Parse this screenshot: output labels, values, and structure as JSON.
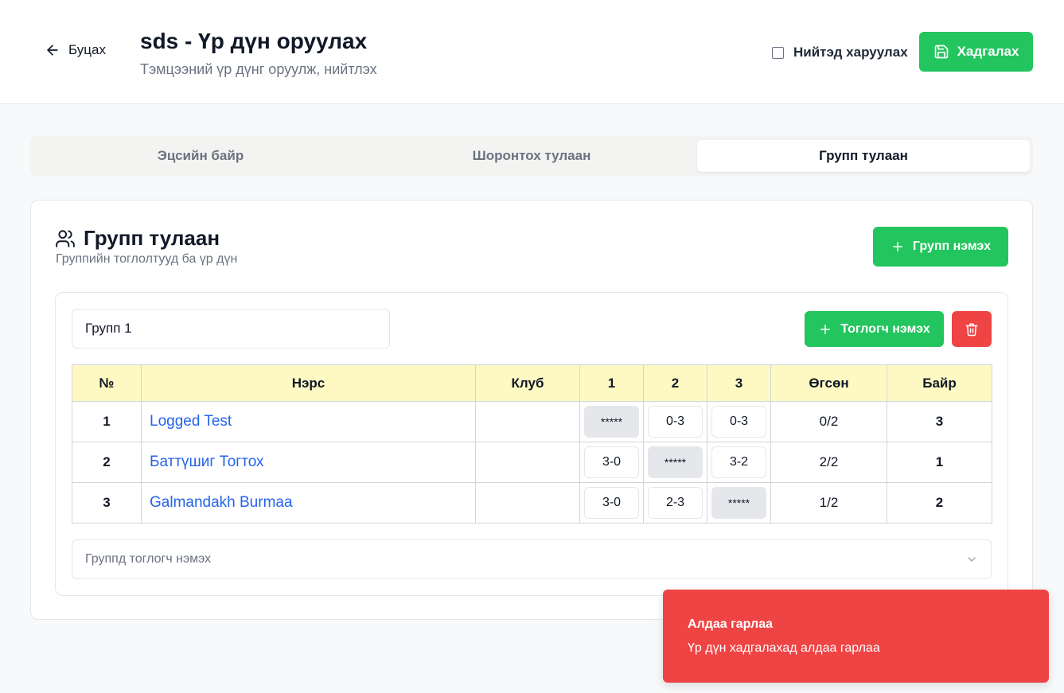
{
  "header": {
    "back_label": "Буцах",
    "title": "sds - Үр дүн оруулах",
    "subtitle": "Тэмцээний үр дүнг оруулж, нийтлэх",
    "publish_label": "Нийтэд харуулах",
    "publish_checked": false,
    "save_label": "Хадгалах"
  },
  "tabs": [
    {
      "label": "Эцсийн байр",
      "active": false
    },
    {
      "label": "Шоронтох тулаан",
      "active": false
    },
    {
      "label": "Групп тулаан",
      "active": true
    }
  ],
  "section": {
    "title": "Групп тулаан",
    "subtitle": "Группийн тоглолтууд ба үр дүн",
    "add_group_label": "Групп нэмэх"
  },
  "group": {
    "name_value": "Групп 1",
    "add_player_label": "Тоглогч нэмэх",
    "columns": [
      "№",
      "Нэрс",
      "Клуб",
      "1",
      "2",
      "3",
      "Өгсөн",
      "Байр"
    ],
    "rows": [
      {
        "num": "1",
        "name": "Logged Test",
        "club": "",
        "scores": [
          "*****",
          "0-3",
          "0-3"
        ],
        "given": "0/2",
        "rank": "3"
      },
      {
        "num": "2",
        "name": "Баттүшиг Тогтох",
        "club": "",
        "scores": [
          "3-0",
          "*****",
          "3-2"
        ],
        "given": "2/2",
        "rank": "1"
      },
      {
        "num": "3",
        "name": "Galmandakh Burmaa",
        "club": "",
        "scores": [
          "3-0",
          "2-3",
          "*****"
        ],
        "given": "1/2",
        "rank": "2"
      }
    ],
    "add_player_select_placeholder": "Группд тоглогч нэмэх"
  },
  "toast": {
    "title": "Алдаа гарлаа",
    "message": "Үр дүн хадгалахад алдаа гарлаа"
  },
  "colors": {
    "primary_green": "#22c55e",
    "danger_red": "#ef4444",
    "link_blue": "#2563eb",
    "table_header_yellow": "#fef9c3"
  }
}
